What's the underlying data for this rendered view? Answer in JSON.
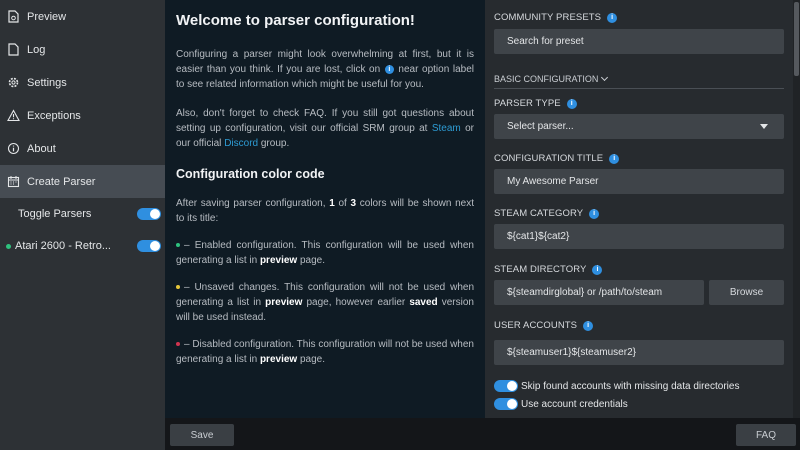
{
  "sidebar": {
    "items": [
      {
        "label": "Preview",
        "icon": "preview-icon"
      },
      {
        "label": "Log",
        "icon": "log-icon"
      },
      {
        "label": "Settings",
        "icon": "gear-icon"
      },
      {
        "label": "Exceptions",
        "icon": "warning-icon"
      },
      {
        "label": "About",
        "icon": "info-icon"
      },
      {
        "label": "Create Parser",
        "icon": "calendar-icon",
        "active": true
      }
    ],
    "toggle_parsers": "Toggle Parsers",
    "parsers": [
      {
        "label": "Atari 2600 - Retro...",
        "status_color": "#2ec27e"
      }
    ]
  },
  "info": {
    "title": "Welcome to parser configuration!",
    "p1_a": "Configuring a parser might look overwhelming at first, but it is easier than you think. If you are lost, click on",
    "p1_b": "near option label to see related information which might be useful for you.",
    "p2_a": "Also, don't forget to check FAQ. If you still got questions about setting up configuration, visit our official SRM group at",
    "p2_link1": "Steam",
    "p2_b": "or our official",
    "p2_link2": "Discord",
    "p2_c": "group.",
    "h2": "Configuration color code",
    "p3_a": "After saving parser configuration,",
    "p3_one": "1",
    "p3_of": "of",
    "p3_three": "3",
    "p3_b": "colors will be shown next to its title:",
    "p4_a": "– Enabled configuration. This configuration will be used when generating a list in",
    "p4_bold": "preview",
    "p4_b": "page.",
    "p5_a": "– Unsaved changes. This configuration will not be used when generating a list in",
    "p5_bold1": "preview",
    "p5_b": "page, however earlier",
    "p5_bold2": "saved",
    "p5_c": "version will be used instead.",
    "p6_a": "– Disabled configuration. This configuration will not be used when generating a list in",
    "p6_bold": "preview",
    "p6_b": "page.",
    "info_glyph": "i",
    "colors": {
      "enabled": "#2ec27e",
      "unsaved": "#e5c63a",
      "disabled": "#d0344f",
      "link": "#2d9bd3"
    }
  },
  "form": {
    "community_presets_label": "COMMUNITY PRESETS",
    "search_preset_placeholder": "Search for preset",
    "basic_configuration": "BASIC CONFIGURATION",
    "parser_type_label": "PARSER TYPE",
    "parser_type_value": "Select parser...",
    "config_title_label": "CONFIGURATION TITLE",
    "config_title_value": "My Awesome Parser",
    "steam_category_label": "STEAM CATEGORY",
    "steam_category_value": "${cat1}${cat2}",
    "steam_directory_label": "STEAM DIRECTORY",
    "steam_directory_value": "${steamdirglobal} or /path/to/steam",
    "browse_label": "Browse",
    "user_accounts_label": "USER ACCOUNTS",
    "user_accounts_value": "${steamuser1}${steamuser2}",
    "skip_accounts_label": "Skip found accounts with missing data directories",
    "use_credentials_label": "Use account credentials"
  },
  "bottombar": {
    "save_label": "Save",
    "faq_label": "FAQ"
  },
  "colors": {
    "accent": "#2f8fe0",
    "sidebar_bg": "#2d3135",
    "info_bg": "#0f1b24",
    "form_bg": "#272b2f"
  }
}
